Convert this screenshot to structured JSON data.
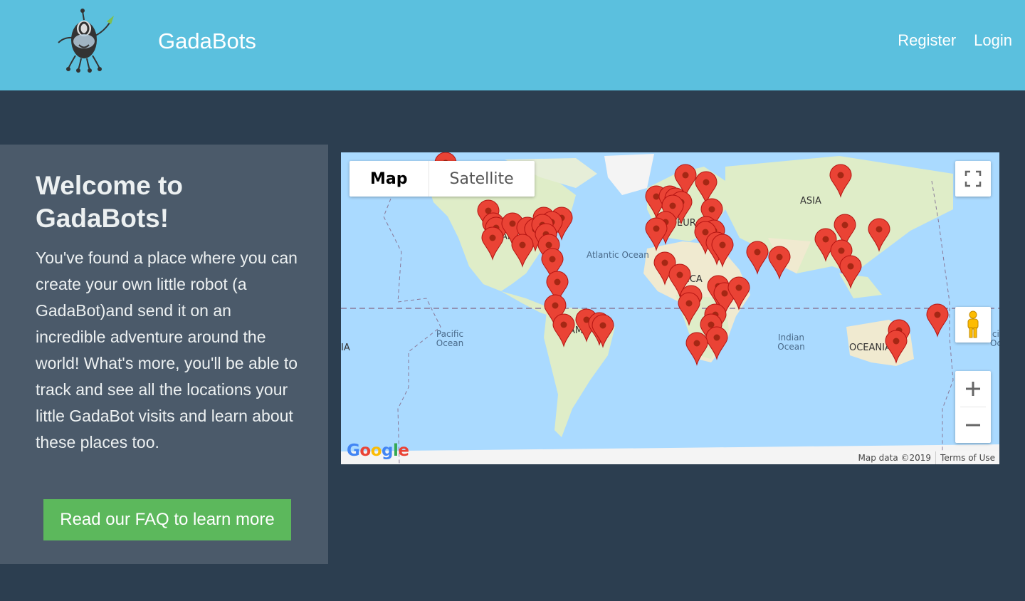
{
  "header": {
    "brand": "GadaBots",
    "nav": {
      "register": "Register",
      "login": "Login"
    }
  },
  "welcome": {
    "title": "Welcome to GadaBots!",
    "body": "You've found a place where you can create your own little robot (a GadaBot)and send it on an incredible adventure around the world! What's more, you'll be able to track and see all the locations your little GadaBot visits and learn about these places too.",
    "button": "Read our FAQ to learn more"
  },
  "map": {
    "type_options": [
      "Map",
      "Satellite"
    ],
    "selected_type": "Map",
    "labels": {
      "atlantic": "Atlantic Ocean",
      "pacific": "Pacific Ocean",
      "indian": "Indian Ocean",
      "asia": "ASIA",
      "europe": "EUR",
      "oceania": "OCEANIA",
      "africa": "ICA",
      "south_america": "AMER",
      "north_america": "AM",
      "pacific_right": "cif\nOcea",
      "left_edge": "IA"
    },
    "attribution": "Map data ©2019",
    "terms": "Terms of Use",
    "google": "Google",
    "colors": {
      "water": "#aadaff",
      "land": "#dfedc8",
      "marker": "#ea4335",
      "marker_dark": "#a52714"
    }
  }
}
